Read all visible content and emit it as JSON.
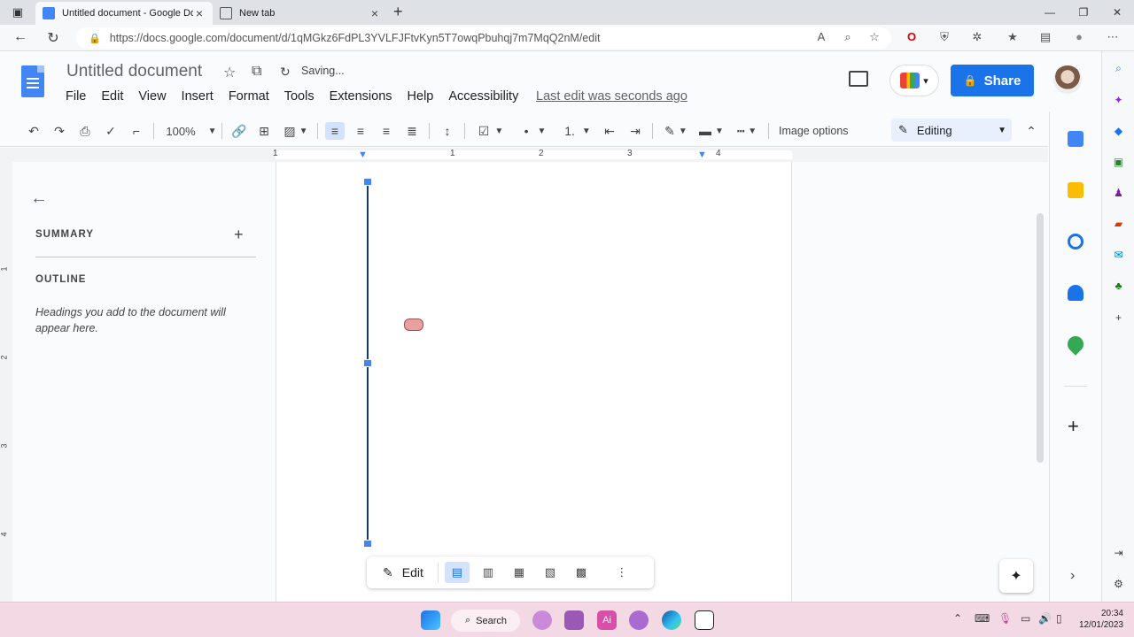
{
  "browser": {
    "tabs": [
      {
        "title": "Untitled document - Google Doc",
        "active": true
      },
      {
        "title": "New tab",
        "active": false
      }
    ],
    "url": "https://docs.google.com/document/d/1qMGkz6FdPL3YVLFJFtvKyn5T7owqPbuhqj7m7MqQ2nM/edit"
  },
  "docs": {
    "title": "Untitled document",
    "save_status": "Saving...",
    "menu": [
      "File",
      "Edit",
      "View",
      "Insert",
      "Format",
      "Tools",
      "Extensions",
      "Help",
      "Accessibility"
    ],
    "last_edit": "Last edit was seconds ago",
    "share_label": "Share",
    "zoom": "100%",
    "image_options": "Image options",
    "mode": "Editing",
    "ruler_numbers": [
      "1",
      "1",
      "2",
      "3",
      "4"
    ],
    "vertical_ruler_numbers": [
      "1",
      "2",
      "3",
      "4"
    ]
  },
  "outline_panel": {
    "summary_label": "SUMMARY",
    "outline_label": "OUTLINE",
    "hint": "Headings you add to the document will appear here."
  },
  "image_bar": {
    "edit_label": "Edit"
  },
  "taskbar": {
    "search_label": "Search",
    "time": "20:34",
    "date": "12/01/2023"
  },
  "colors": {
    "accent": "#1a73e8",
    "docs_blue": "#4285f4",
    "taskbar": "#f3d9e3"
  }
}
